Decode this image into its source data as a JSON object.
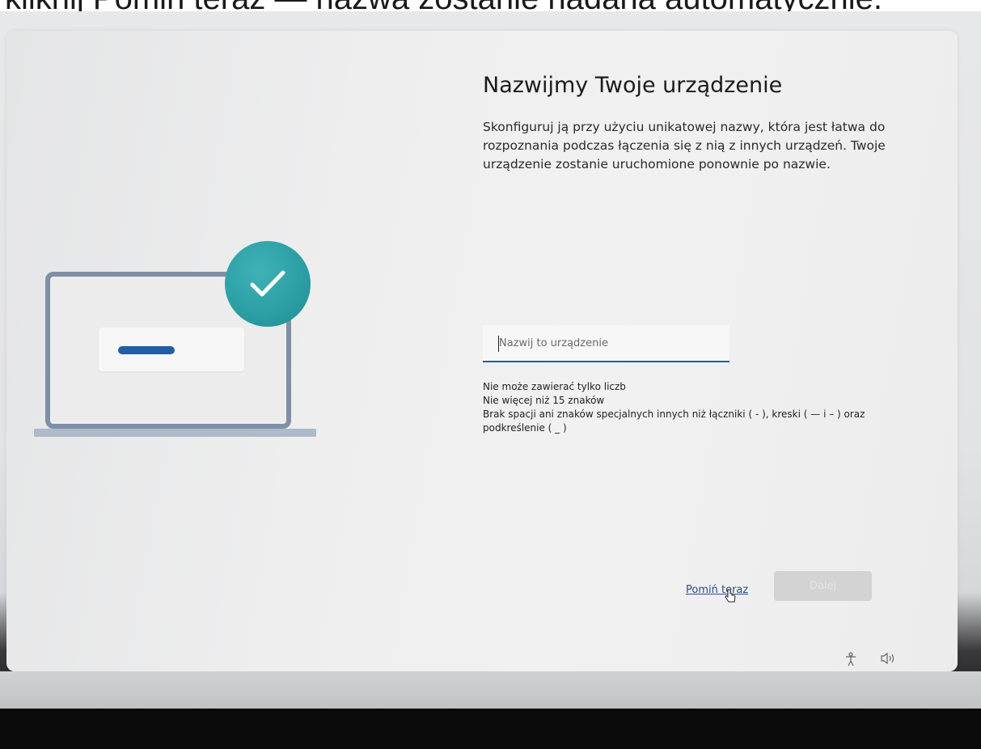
{
  "caption": {
    "text": "kliknij Pomiń teraz — nazwa zostanie nadana automatycznie."
  },
  "page": {
    "title": "Nazwijmy Twoje urządzenie",
    "subtitle": "Skonfiguruj ją przy użyciu unikatowej nazwy, która jest łatwa do rozpoznania podczas łączenia się z nią z innych urządzeń. Twoje urządzenie zostanie uruchomione ponownie po nazwie."
  },
  "name_field": {
    "value": "",
    "placeholder": "Nazwij to urządzenie"
  },
  "rules": [
    "Nie może zawierać tylko liczb",
    "Nie więcej niż 15 znaków",
    "Brak spacji ani znaków specjalnych innych niż łączniki ( - ), kreski ( — i – ) oraz",
    "podkreślenie ( _ )"
  ],
  "buttons": {
    "skip_label": "Pomiń teraz",
    "next_label": "Dalej"
  },
  "icons": {
    "check": "checkmark-icon",
    "accessibility": "accessibility-icon",
    "volume": "volume-icon"
  },
  "colors": {
    "accent": "#1f5fa8",
    "check_circle": "#2a9ea3",
    "link": "#2b4f86"
  }
}
